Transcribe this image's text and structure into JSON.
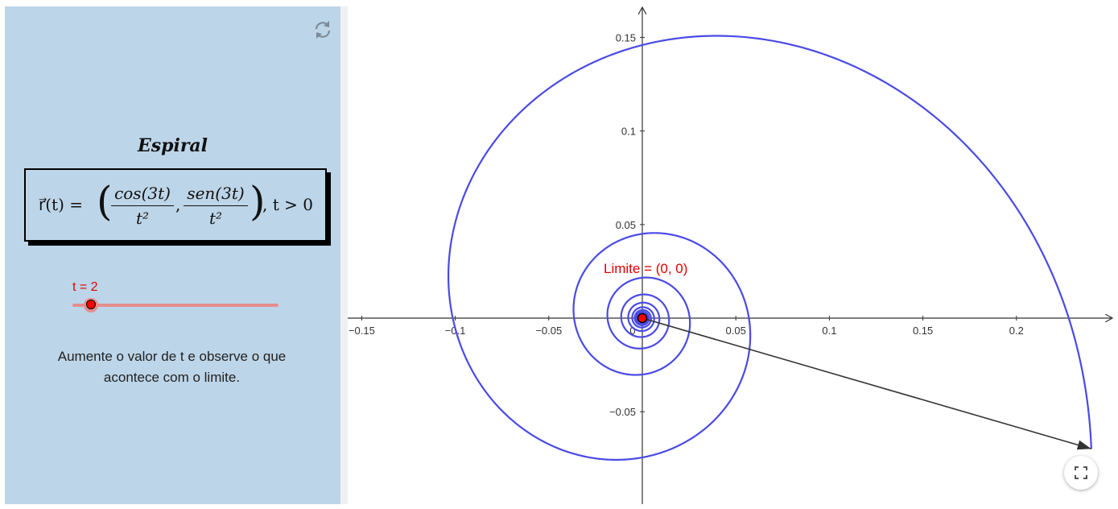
{
  "sidebar": {
    "title": "Espiral",
    "formula": {
      "lhs": "r⃗(t) = ",
      "frac1_num": "cos(3t)",
      "frac1_den": "t²",
      "frac2_num": "sen(3t)",
      "frac2_den": "t²",
      "tail": ", t > 0"
    },
    "slider": {
      "label": "t = 2",
      "value": 2,
      "position_fraction": 0.09
    },
    "hint": "Aumente o valor de t e observe o que acontece com o limite.",
    "reset_icon": "refresh-icon"
  },
  "graph": {
    "x_ticks": [
      "−0.15",
      "−0.1",
      "−0.05",
      "0",
      "0.05",
      "0.1",
      "0.15",
      "0.2"
    ],
    "y_ticks": [
      "0.15",
      "0.1",
      "0.05",
      "−0.05"
    ],
    "limit_label": "Limite = (0, 0)",
    "colors": {
      "curve": "#4a4ae6",
      "point": "#ff0000",
      "limit_text": "#e00000",
      "vector": "#333333",
      "axes": "#333333"
    },
    "curve": {
      "x": "cos(3t)/t²",
      "y": "sen(3t)/t²",
      "t_from": 2,
      "t_to": 400
    },
    "vector_end": {
      "x": 0.24,
      "y": -0.0698
    },
    "fullscreen_icon": "fullscreen-icon"
  }
}
